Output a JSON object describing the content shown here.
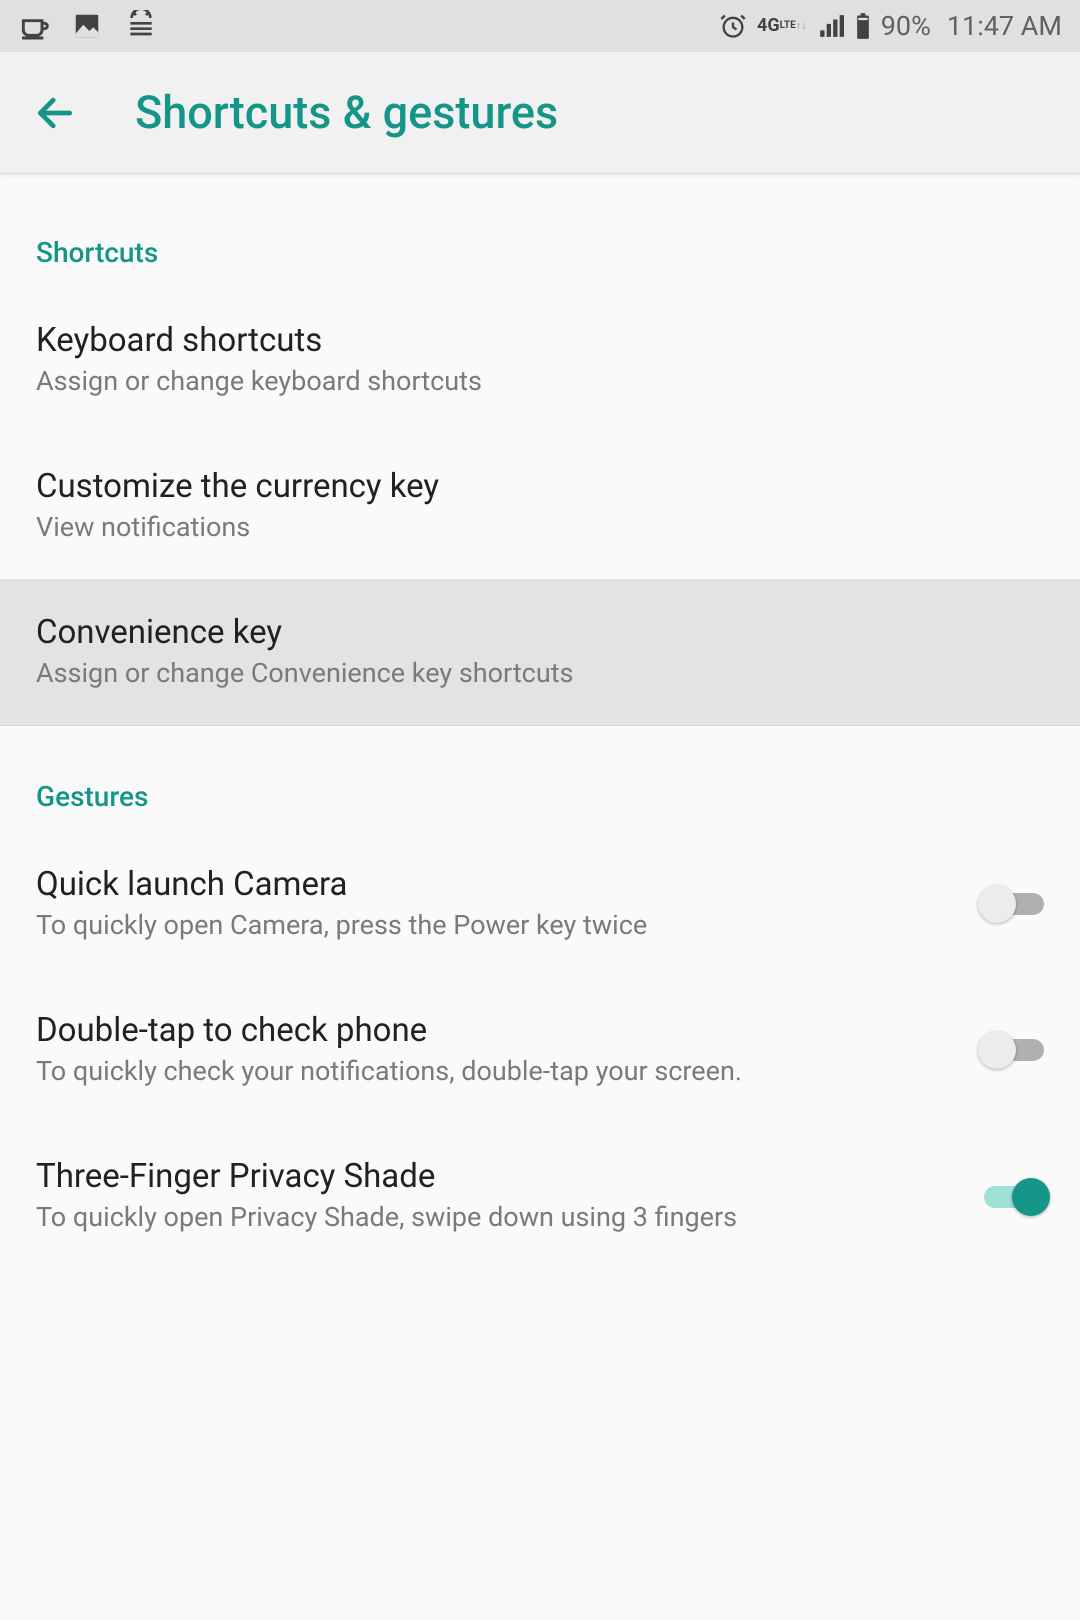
{
  "status": {
    "battery": "90%",
    "time": "11:47 AM",
    "network_label": "4G"
  },
  "header": {
    "title": "Shortcuts & gestures"
  },
  "sections": {
    "shortcuts": {
      "header": "Shortcuts",
      "items": [
        {
          "title": "Keyboard shortcuts",
          "sub": "Assign or change keyboard shortcuts"
        },
        {
          "title": "Customize the currency key",
          "sub": "View notifications"
        },
        {
          "title": "Convenience key",
          "sub": "Assign or change Convenience key shortcuts"
        }
      ]
    },
    "gestures": {
      "header": "Gestures",
      "items": [
        {
          "title": "Quick launch Camera",
          "sub": "To quickly open Camera, press the Power key twice",
          "on": false
        },
        {
          "title": "Double-tap to check phone",
          "sub": "To quickly check your notifications, double-tap your screen.",
          "on": false
        },
        {
          "title": "Three-Finger Privacy Shade",
          "sub": "To quickly open Privacy Shade, swipe down using 3 fingers",
          "on": true
        }
      ]
    }
  }
}
